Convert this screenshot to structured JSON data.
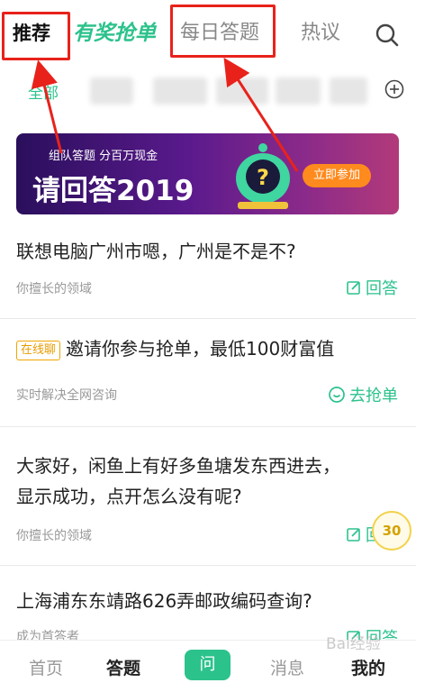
{
  "tabs": {
    "recommend": "推荐",
    "prize": "有奖抢单",
    "daily": "每日答题",
    "hot": "热议"
  },
  "categories": {
    "all": "全部"
  },
  "banner": {
    "top_line": "组队答题 分百万现金",
    "title": "请回答2019",
    "button": "立即参加"
  },
  "questions": [
    {
      "title": "联想电脑广州市嗯，广州是不是不?",
      "meta": "你擅长的领域",
      "action": "回答",
      "action_icon": "edit-icon"
    },
    {
      "badge": "在线聊",
      "title": "邀请你参与抢单，最低100财富值",
      "meta": "实时解决全网咨询",
      "action": "去抢单",
      "action_icon": "chat-icon"
    },
    {
      "title_line1": "大家好，闲鱼上有好多鱼塘发东西进去，",
      "title_line2": "显示成功，点开怎么没有呢?",
      "meta": "你擅长的领域",
      "action": "回答",
      "action_icon": "edit-icon"
    },
    {
      "title": "上海浦东东靖路626弄邮政编码查询?",
      "meta": "成为首答者",
      "action": "回答",
      "action_icon": "edit-icon"
    }
  ],
  "coin": "30",
  "bottom_nav": {
    "home": "首页",
    "answer": "答题",
    "ask": "问",
    "message": "消息",
    "me": "我的"
  },
  "watermark": "Bai经验",
  "colors": {
    "accent": "#2cc28c",
    "highlight": "#e8221b",
    "badge": "#e89c00"
  }
}
